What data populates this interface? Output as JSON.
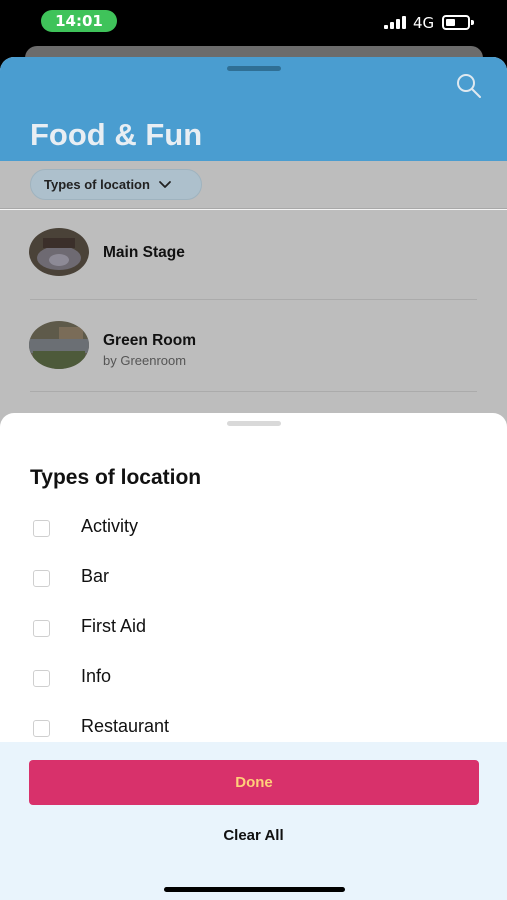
{
  "status_bar": {
    "time": "14:01",
    "network": "4G"
  },
  "app": {
    "title": "Food & Fun",
    "filter_chip_label": "Types of location",
    "icons": [
      "search-icon",
      "chevron-down-icon"
    ],
    "list_items": [
      {
        "name": "Main Stage",
        "subtitle": ""
      },
      {
        "name": "Green Room",
        "subtitle": "by Greenroom"
      }
    ]
  },
  "sheet": {
    "title": "Types of location",
    "options": [
      {
        "label": "Activity",
        "checked": false
      },
      {
        "label": "Bar",
        "checked": false
      },
      {
        "label": "First Aid",
        "checked": false
      },
      {
        "label": "Info",
        "checked": false
      },
      {
        "label": "Restaurant",
        "checked": false
      }
    ],
    "done_label": "Done",
    "clear_label": "Clear All"
  },
  "colors": {
    "header": "#4a9dd0",
    "done_button": "#d8316b",
    "done_text": "#ffcf7a",
    "status_pill": "#3fc35a"
  }
}
